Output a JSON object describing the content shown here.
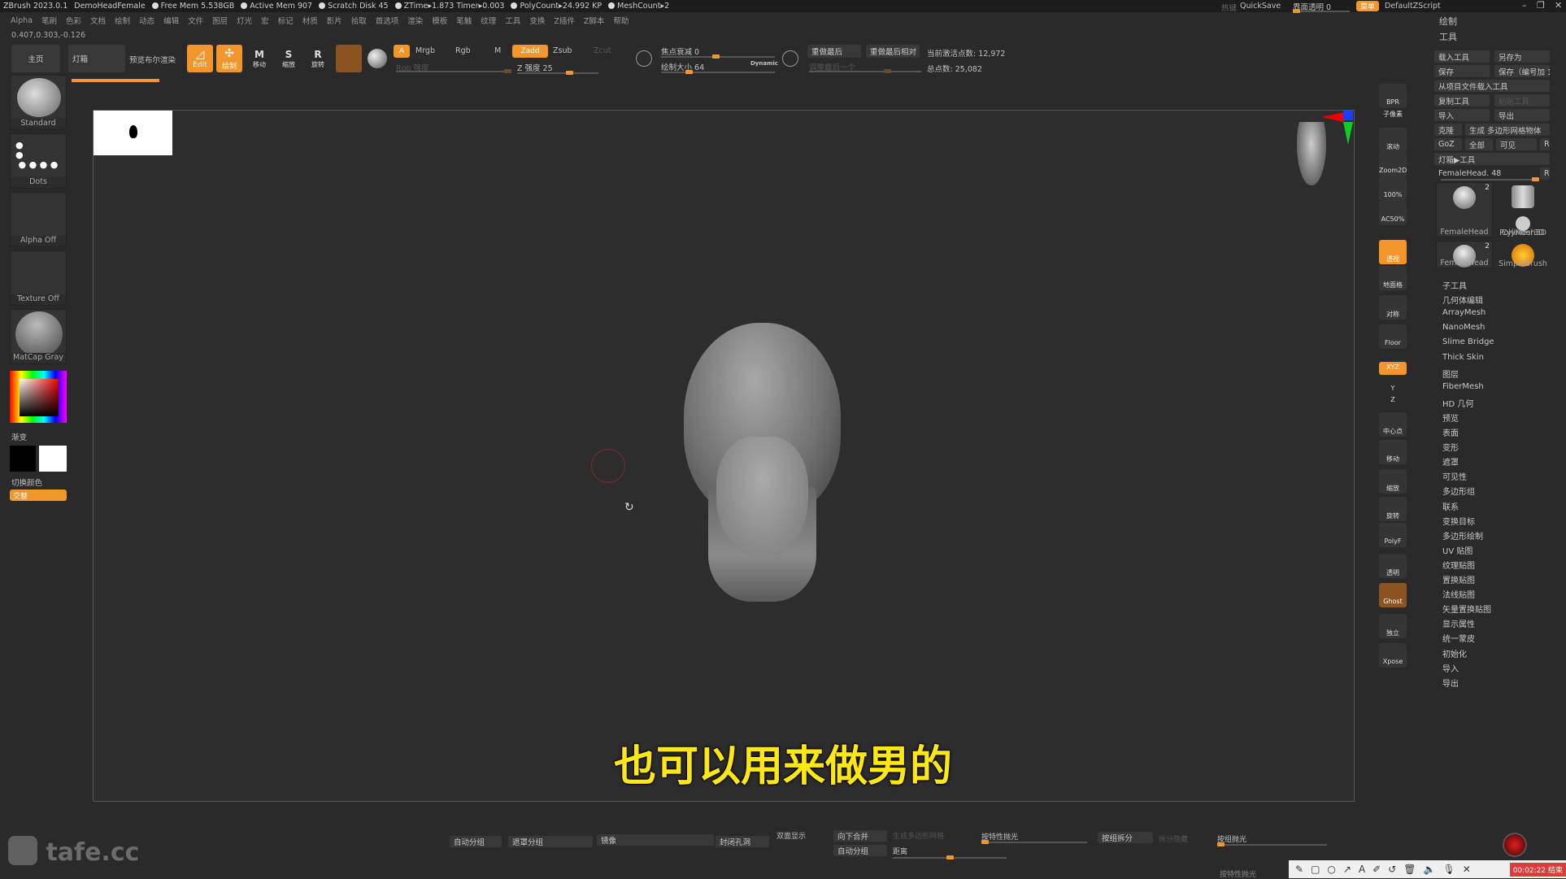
{
  "titlebar": {
    "app": "ZBrush 2023.0.1",
    "doc": "DemoHeadFemale",
    "stats": [
      "Free Mem 5.538GB",
      "Active Mem 907",
      "Scratch Disk 45",
      "ZTime▸1.873 Timer▸0.003",
      "PolyCount▸24.992 KP",
      "MeshCount▸2"
    ],
    "right": {
      "hint": "热键",
      "quicksave": "QuickSave",
      "transparency": "界面透明 0",
      "menu": "菜单",
      "script": "DefaultZScript"
    }
  },
  "menubar": [
    "Alpha",
    "笔刷",
    "色彩",
    "文档",
    "绘制",
    "动态",
    "编辑",
    "文件",
    "图层",
    "灯光",
    "宏",
    "标记",
    "材质",
    "影片",
    "拾取",
    "首选项",
    "渲染",
    "模板",
    "笔触",
    "纹理",
    "工具",
    "变换",
    "Z插件",
    "Z脚本",
    "帮助"
  ],
  "coords": "0.407,0.303,-0.126",
  "toolbar": {
    "home": "主页",
    "lightbox": "灯箱",
    "bpr": "预览布尔渲染",
    "edit": "Edit",
    "draw": "绘制",
    "move": "移动",
    "scale": "缩放",
    "rotate": "旋转",
    "a": "A",
    "mrgb": "Mrgb",
    "rgb": "Rgb",
    "m": "M",
    "zadd": "Zadd",
    "zsub": "Zsub",
    "zcut": "Zcut",
    "rgb_intensity": "Rgb 强度",
    "z_intensity": "Z 强度 25",
    "focal": "焦点衰减 0",
    "draw_size": "绘制大小 64",
    "dynamic": "Dynamic",
    "redo_last": "重做最后",
    "redo_last_rel": "重做最后相对",
    "adjust_last": "调整最后一个",
    "active_points": "当前激活点数: 12,972",
    "total_points": "总点数: 25,082"
  },
  "left": {
    "brush": "Standard",
    "stroke": "Dots",
    "alpha": "Alpha Off",
    "texture": "Texture Off",
    "material": "MatCap Gray",
    "gradient": "渐变",
    "switch_color": "切换颜色",
    "alternate": "交替"
  },
  "subtitle": "也可以用来做男的",
  "shelf": [
    "BPR",
    "子像素",
    "滚动",
    "Zoom2D",
    "100%",
    "AC50%",
    "透视",
    "地面格",
    "对称",
    "Floor",
    "XYZ",
    "Y",
    "Z",
    "中心点",
    "移动",
    "缩放",
    "旋转",
    "PolyF",
    "透明",
    "Ghost",
    "独立",
    "Xpose"
  ],
  "rpanel": {
    "draw_header": "绘制",
    "tool_header": "工具",
    "buttons": [
      "载入工具",
      "另存为",
      "保存",
      "保存（编号加 1）",
      "从项目文件载入工具",
      "复制工具",
      "粘贴工具",
      "导入",
      "导出",
      "克隆",
      "生成 多边形网格物体",
      "GoZ",
      "全部",
      "可见",
      "R",
      "灯箱▶工具",
      "FemaleHead. 48",
      "R"
    ],
    "tools": [
      {
        "name": "FemaleHead",
        "count": "2"
      },
      {
        "name": "Cylinder3D"
      },
      {
        "name": "PolyMesh3D"
      },
      {
        "name": "FemaleHead",
        "count": "2"
      },
      {
        "name": "SimpleBrush"
      }
    ],
    "sections": [
      "子工具",
      "几何体编辑",
      "ArrayMesh",
      "NanoMesh",
      "Slime Bridge",
      "Thick Skin",
      "图层",
      "FiberMesh",
      "HD 几何",
      "预览",
      "表面",
      "变形",
      "遮罩",
      "可见性",
      "多边形组",
      "联系",
      "变换目标",
      "多边形绘制",
      "UV 贴图",
      "纹理贴图",
      "置换贴图",
      "法线贴图",
      "矢量置换贴图",
      "显示属性",
      "统一蒙皮",
      "初始化",
      "导入",
      "导出"
    ]
  },
  "bottom": {
    "auto_group": "自动分组",
    "group_visible": "遮罩分组",
    "mirror": "镜像",
    "close_holes": "封闭孔洞",
    "double": "双面显示",
    "merge_down": "向下合并",
    "gen_poly": "生成多边形网格",
    "auto_group2": "自动分组",
    "dist": "距离",
    "polish_feature": "按特性抛光",
    "group_split": "按组拆分",
    "split_hidden": "拆分隐藏",
    "polish_group": "按组抛光",
    "polish_feature2": "按特性抛光"
  },
  "watermark": "tafe.cc",
  "recorder": {
    "timer": "00:02:22 结束"
  },
  "colors": {
    "accent": "#f2952a",
    "subtitle": "#ffe812",
    "bg": "#2a2a2a"
  }
}
